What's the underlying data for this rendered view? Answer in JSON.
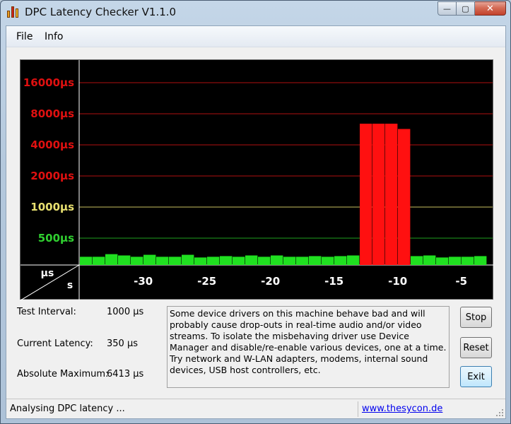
{
  "window": {
    "title": "DPC Latency Checker V1.1.0",
    "caption_min": "—",
    "caption_max": "▢",
    "caption_close": "✕"
  },
  "menu": {
    "file": "File",
    "info": "Info"
  },
  "chart_data": {
    "type": "bar",
    "y_scale": "log2",
    "y_ticks": [
      {
        "label": "16000µs",
        "value": 16000,
        "color": "#e01010"
      },
      {
        "label": "8000µs",
        "value": 8000,
        "color": "#e01010"
      },
      {
        "label": "4000µs",
        "value": 4000,
        "color": "#e01010"
      },
      {
        "label": "2000µs",
        "value": 2000,
        "color": "#e01010"
      },
      {
        "label": "1000µs",
        "value": 1000,
        "color": "#e8e070"
      },
      {
        "label": "500µs",
        "value": 500,
        "color": "#30d030"
      }
    ],
    "x_ticks": [
      -30,
      -25,
      -20,
      -15,
      -10,
      -5
    ],
    "x_tick_labels": [
      "-30",
      "-25",
      "-20",
      "-15",
      "-10",
      "-5"
    ],
    "x_range": [
      -34,
      -1
    ],
    "corner_y_unit": "µs",
    "corner_x_unit": "s",
    "bars": [
      {
        "x": -34,
        "value": 330
      },
      {
        "x": -33,
        "value": 330
      },
      {
        "x": -32,
        "value": 350
      },
      {
        "x": -31,
        "value": 340
      },
      {
        "x": -30,
        "value": 330
      },
      {
        "x": -29,
        "value": 345
      },
      {
        "x": -28,
        "value": 330
      },
      {
        "x": -27,
        "value": 330
      },
      {
        "x": -26,
        "value": 345
      },
      {
        "x": -25,
        "value": 325
      },
      {
        "x": -24,
        "value": 330
      },
      {
        "x": -23,
        "value": 335
      },
      {
        "x": -22,
        "value": 330
      },
      {
        "x": -21,
        "value": 340
      },
      {
        "x": -20,
        "value": 330
      },
      {
        "x": -19,
        "value": 340
      },
      {
        "x": -18,
        "value": 330
      },
      {
        "x": -17,
        "value": 330
      },
      {
        "x": -16,
        "value": 335
      },
      {
        "x": -15,
        "value": 330
      },
      {
        "x": -14,
        "value": 335
      },
      {
        "x": -13,
        "value": 340
      },
      {
        "x": -12,
        "value": 6413
      },
      {
        "x": -11,
        "value": 6413
      },
      {
        "x": -10,
        "value": 6413
      },
      {
        "x": -9,
        "value": 5700
      },
      {
        "x": -8,
        "value": 335
      },
      {
        "x": -7,
        "value": 340
      },
      {
        "x": -6,
        "value": 325
      },
      {
        "x": -5,
        "value": 330
      },
      {
        "x": -4,
        "value": 330
      },
      {
        "x": -3,
        "value": 335
      },
      {
        "x": -2,
        "value": 330
      },
      {
        "x": -1,
        "value": 350
      },
      {
        "x": 0,
        "value": 325
      }
    ],
    "bar_colors": {
      "normal": "#20e020",
      "high": "#ff1010"
    },
    "high_threshold": 1000
  },
  "info": {
    "test_interval_label": "Test Interval:",
    "test_interval_value": "1000 µs",
    "current_latency_label": "Current Latency:",
    "current_latency_value": "350 µs",
    "absolute_max_label": "Absolute Maximum:",
    "absolute_max_value": "6413 µs"
  },
  "message": "Some device drivers on this machine behave bad and will probably cause drop-outs in real-time audio and/or video streams. To isolate the misbehaving driver use Device Manager and disable/re-enable various devices, one at a time. Try network and W-LAN adapters, modems, internal sound devices, USB host controllers, etc.",
  "buttons": {
    "stop": "Stop",
    "reset": "Reset",
    "exit": "Exit"
  },
  "status": {
    "text": "Analysing DPC latency ...",
    "link": "www.thesycon.de"
  }
}
